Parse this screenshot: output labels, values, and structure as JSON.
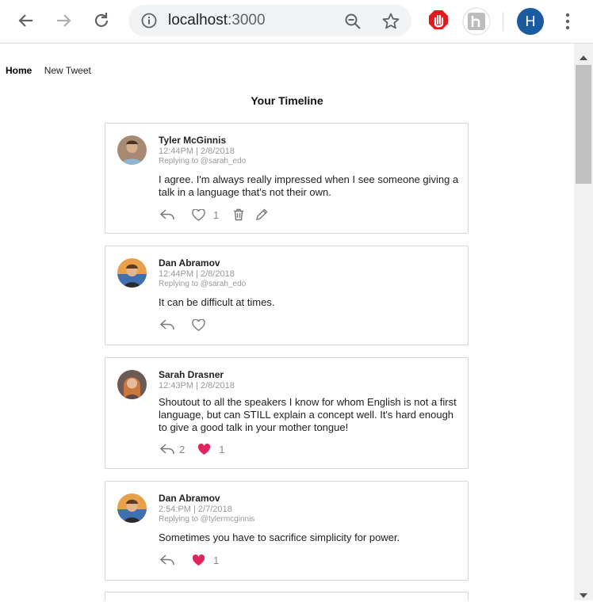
{
  "browser": {
    "url_host": "localhost",
    "url_port": ":3000",
    "profile_initial": "H"
  },
  "nav": {
    "home": "Home",
    "new_tweet": "New Tweet"
  },
  "page": {
    "title": "Your Timeline"
  },
  "tweets": [
    {
      "author": "Tyler McGinnis",
      "time": "12:44PM | 2/8/2018",
      "reply": "Replying to @sarah_edo",
      "text": "I agree. I'm always really impressed when I see someone giving a talk in a language that's not their own.",
      "replies": "",
      "likes": "1",
      "liked": false
    },
    {
      "author": "Dan Abramov",
      "time": "12:44PM | 2/8/2018",
      "reply": "Replying to @sarah_edo",
      "text": "It can be difficult at times.",
      "replies": "",
      "likes": "",
      "liked": false
    },
    {
      "author": "Sarah Drasner",
      "time": "12:43PM | 2/8/2018",
      "reply": "",
      "text": "Shoutout to all the speakers I know for whom English is not a first language, but can STILL explain a concept well. It's hard enough to give a good talk in your mother tongue!",
      "replies": "2",
      "likes": "1",
      "liked": true
    },
    {
      "author": "Dan Abramov",
      "time": "2:54:PM | 2/7/2018",
      "reply": "Replying to @tylermcginnis",
      "text": "Sometimes you have to sacrifice simplicity for power.",
      "replies": "",
      "likes": "1",
      "liked": true
    }
  ],
  "colors": {
    "liked": "#e0245e",
    "icon": "#777777"
  }
}
